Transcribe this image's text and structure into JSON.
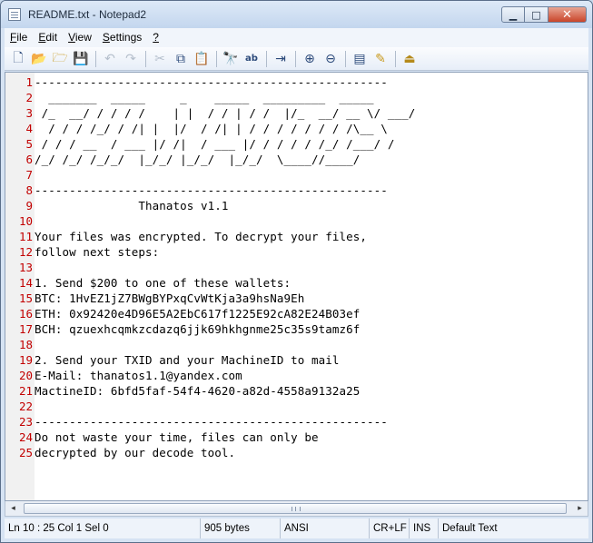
{
  "window": {
    "title": "README.txt - Notepad2",
    "minimize_glyph": "▁",
    "maximize_glyph": "□",
    "close_glyph": "✕"
  },
  "menu": {
    "items": [
      {
        "key": "F",
        "rest": "ile"
      },
      {
        "key": "E",
        "rest": "dit"
      },
      {
        "key": "V",
        "rest": "iew"
      },
      {
        "key": "S",
        "rest": "ettings"
      },
      {
        "key": "?",
        "rest": ""
      }
    ]
  },
  "toolbar": {
    "icons": {
      "new": "🗋",
      "open": "📂",
      "browse": "🗁",
      "save": "💾",
      "undo": "↶",
      "redo": "↷",
      "cut": "✂",
      "copy": "⧉",
      "paste": "📋",
      "find": "🔭",
      "replace": "ab",
      "goto": "⇥",
      "zoom_in": "⊕",
      "zoom_out": "⊖",
      "scheme": "▤",
      "scheme_config": "✎",
      "exit": "⏏"
    }
  },
  "editor": {
    "lines": [
      "---------------------------------------------------",
      "  _______  _____     _    _____  _________  _____",
      " /_  __/ / / / /    | |  / / | / /  |/_  __/ __ \\/ ___/",
      "  / / / /_/ / /| |  |/  / /| | / / / / / / / /\\__ \\",
      " / / / __  / ___ |/ /|  / ___ |/ / / / / /_/ /___/ /",
      "/_/ /_/ /_/_/  |_/_/ |_/_/  |_/_/  \\____//____/",
      "",
      "---------------------------------------------------",
      "               Thanatos v1.1",
      "",
      "Your files was encrypted. To decrypt your files,",
      "follow next steps:",
      "",
      "1. Send $200 to one of these wallets:",
      "BTC: 1HvEZ1jZ7BWgBYPxqCvWtKja3a9hsNa9Eh",
      "ETH: 0x92420e4D96E5A2EbC617f1225E92cA82E24B03ef",
      "BCH: qzuexhcqmkzcdazq6jjk69hkhgnme25c35s9tamz6f",
      "",
      "2. Send your TXID and your MachineID to mail",
      "E-Mail: thanatos1.1@yandex.com",
      "MactineID: 6bfd5faf-54f4-4620-a82d-4558a9132a25",
      "",
      "---------------------------------------------------",
      "Do not waste your time, files can only be",
      "decrypted by our decode tool."
    ]
  },
  "scrollbar": {
    "left_glyph": "◂",
    "right_glyph": "▸"
  },
  "statusbar": {
    "position": "Ln 10 : 25   Col 1   Sel 0",
    "size": "905 bytes",
    "encoding": "ANSI",
    "eol": "CR+LF",
    "mode": "INS",
    "scheme": "Default Text"
  }
}
